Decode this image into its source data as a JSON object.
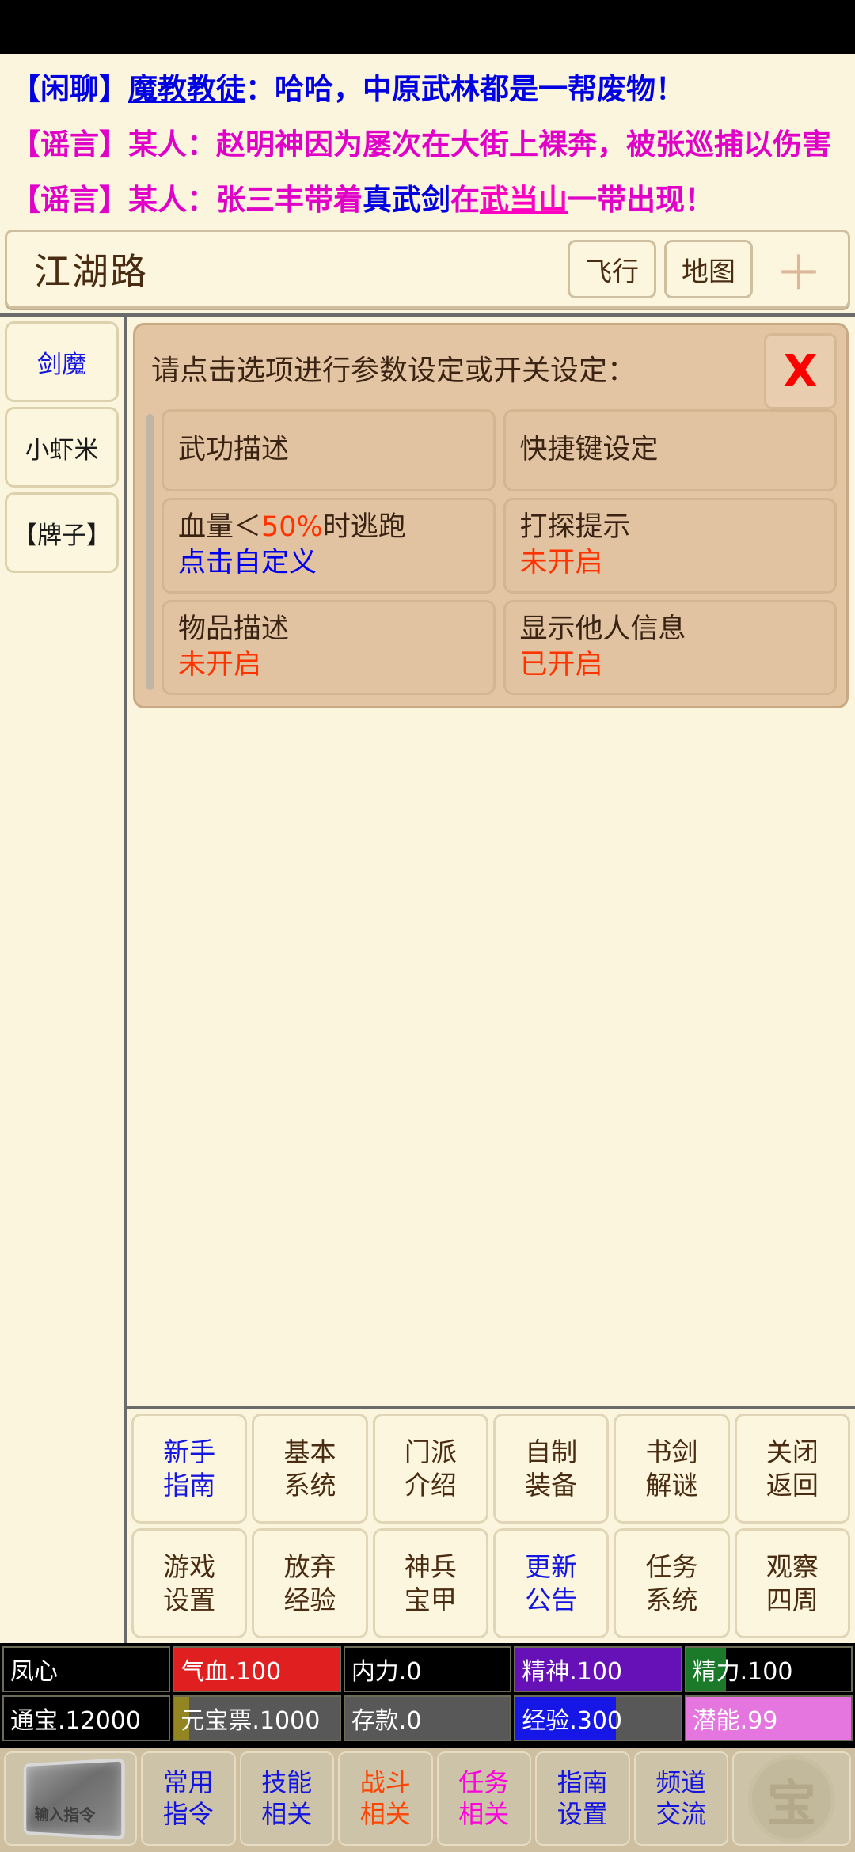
{
  "chat": {
    "lines": [
      {
        "segments": [
          {
            "text": "【闲聊】",
            "color": "blue",
            "underline": false
          },
          {
            "text": "魔教教徒",
            "color": "blue",
            "underline": true
          },
          {
            "text": "：哈哈，中原武林都是一帮废物！",
            "color": "blue",
            "underline": false
          }
        ]
      },
      {
        "segments": [
          {
            "text": "【谣言】某人：赵明神因为屡次在大街上裸奔，被张巡捕以伤害",
            "color": "magenta",
            "underline": false
          }
        ]
      },
      {
        "segments": [
          {
            "text": "【谣言】某人：张三丰带着",
            "color": "magenta",
            "underline": false
          },
          {
            "text": "真武剑",
            "color": "blue",
            "underline": false
          },
          {
            "text": "在",
            "color": "magenta",
            "underline": false
          },
          {
            "text": "武当山",
            "color": "pink",
            "underline": true
          },
          {
            "text": "一带出现！",
            "color": "magenta",
            "underline": false
          }
        ]
      }
    ]
  },
  "header": {
    "location": "江湖路",
    "fly_label": "飞行",
    "map_label": "地图",
    "plus_label": "＋"
  },
  "sidebar": {
    "items": [
      {
        "label": "剑魔",
        "color": "blue"
      },
      {
        "label": "小虾米",
        "color": "black"
      },
      {
        "label": "【牌子】",
        "color": "black"
      }
    ]
  },
  "dialog": {
    "title": "请点击选项进行参数设定或开关设定：",
    "close_label": "X",
    "options": [
      {
        "name": "武功描述",
        "value": "",
        "value_color": ""
      },
      {
        "name": "快捷键设定",
        "value": "",
        "value_color": ""
      },
      {
        "name_pre": "血量＜",
        "name_pct": "50%",
        "name_post": "时逃跑",
        "value": "点击自定义",
        "value_color": "blue"
      },
      {
        "name": "打探提示",
        "value": "未开启",
        "value_color": "red"
      },
      {
        "name": "物品描述",
        "value": "未开启",
        "value_color": "red"
      },
      {
        "name": "显示他人信息",
        "value": "已开启",
        "value_color": "red"
      }
    ]
  },
  "help_grid": {
    "cells": [
      {
        "l1": "新手",
        "l2": "指南",
        "color": "blue"
      },
      {
        "l1": "基本",
        "l2": "系统",
        "color": "brown"
      },
      {
        "l1": "门派",
        "l2": "介绍",
        "color": "brown"
      },
      {
        "l1": "自制",
        "l2": "装备",
        "color": "brown"
      },
      {
        "l1": "书剑",
        "l2": "解谜",
        "color": "brown"
      },
      {
        "l1": "关闭",
        "l2": "返回",
        "color": "brown"
      },
      {
        "l1": "游戏",
        "l2": "设置",
        "color": "brown"
      },
      {
        "l1": "放弃",
        "l2": "经验",
        "color": "brown"
      },
      {
        "l1": "神兵",
        "l2": "宝甲",
        "color": "brown"
      },
      {
        "l1": "更新",
        "l2": "公告",
        "color": "blue"
      },
      {
        "l1": "任务",
        "l2": "系统",
        "color": "brown"
      },
      {
        "l1": "观察",
        "l2": "四周",
        "color": "brown"
      }
    ]
  },
  "stats": {
    "row1": [
      {
        "label": "凤心",
        "fill_pct": 0,
        "fill_color": "#000000",
        "bg": "#000000"
      },
      {
        "label": "气血.100",
        "fill_pct": 100,
        "fill_color": "#e02020",
        "bg": "#000000"
      },
      {
        "label": "内力.0",
        "fill_pct": 0,
        "fill_color": "#000000",
        "bg": "#000000"
      },
      {
        "label": "精神.100",
        "fill_pct": 100,
        "fill_color": "#6610b8",
        "bg": "#000000"
      },
      {
        "label": "精力.100",
        "fill_pct": 24,
        "fill_color": "#1a7a2a",
        "bg": "#000000"
      }
    ],
    "row2": [
      {
        "label": "通宝.12000",
        "fill_pct": 0,
        "fill_color": "#000000",
        "bg": "#000000"
      },
      {
        "label": "元宝票.1000",
        "fill_pct": 9,
        "fill_color": "#938622",
        "bg": "#585858"
      },
      {
        "label": "存款.0",
        "fill_pct": 0,
        "fill_color": "#585858",
        "bg": "#585858"
      },
      {
        "label": "经验.300",
        "fill_pct": 61,
        "fill_color": "#1616e6",
        "bg": "#585858"
      },
      {
        "label": "潜能.99",
        "fill_pct": 100,
        "fill_color": "#e576e0",
        "bg": "#585858"
      }
    ]
  },
  "toolbar": {
    "command_box_label": "输入指令",
    "buttons": [
      {
        "l1": "常用",
        "l2": "指令",
        "color": "blue"
      },
      {
        "l1": "技能",
        "l2": "相关",
        "color": "blue"
      },
      {
        "l1": "战斗",
        "l2": "相关",
        "color": "orange"
      },
      {
        "l1": "任务",
        "l2": "相关",
        "color": "magenta"
      },
      {
        "l1": "指南",
        "l2": "设置",
        "color": "blue"
      },
      {
        "l1": "频道",
        "l2": "交流",
        "color": "blue"
      }
    ],
    "seal_label": "宝"
  }
}
